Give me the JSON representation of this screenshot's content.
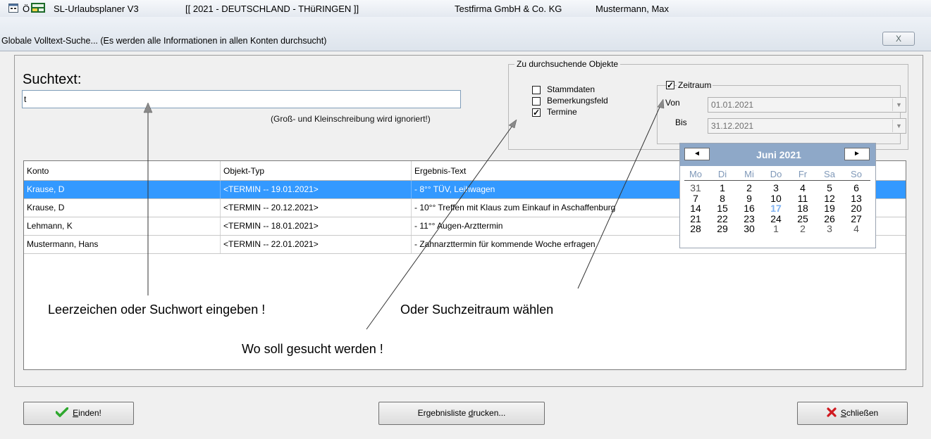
{
  "window": {
    "app_title": "SL-Urlaubsplaner V3",
    "context": "[[ 2021 - DEUTSCHLAND - THüRINGEN ]]",
    "company": "Testfirma GmbH & Co. KG",
    "user": "Mustermann, Max",
    "small_label": "Ö"
  },
  "dialog": {
    "title": "Globale Volltext-Suche... (Es werden alle Informationen in allen Konten durchsucht)",
    "close_label": "X"
  },
  "search": {
    "label": "Suchtext:",
    "value": "t",
    "hint": "(Groß- und Kleinschreibung wird ignoriert!)"
  },
  "objects": {
    "legend": "Zu durchsuchende Objekte",
    "stammdaten": {
      "label": "Stammdaten",
      "checked": false
    },
    "bemerkung": {
      "label": "Bemerkungsfeld",
      "checked": false
    },
    "termine": {
      "label": "Termine",
      "checked": true
    },
    "zeitraum": {
      "label": "Zeitraum",
      "checked": true,
      "von_label": "Von",
      "von_value": "01.01.2021",
      "bis_label": "Bis",
      "bis_value": "31.12.2021"
    }
  },
  "table": {
    "columns": [
      "Konto",
      "Objekt-Typ",
      "Ergebnis-Text"
    ],
    "rows": [
      {
        "konto": "Krause, D",
        "typ": "<TERMIN -- 19.01.2021>",
        "text": "- 8°° TÜV, Leihwagen",
        "selected": true
      },
      {
        "konto": "Krause, D",
        "typ": "<TERMIN -- 20.12.2021>",
        "text": "- 10°° Treffen mit Klaus zum Einkauf in Aschaffenburg",
        "selected": false
      },
      {
        "konto": "Lehmann, K",
        "typ": "<TERMIN -- 18.01.2021>",
        "text": "- 11°° Augen-Arzttermin",
        "selected": false
      },
      {
        "konto": "Mustermann, Hans",
        "typ": "<TERMIN -- 22.01.2021>",
        "text": "- Zahnarzttermin für kommende Woche erfragen",
        "selected": false
      }
    ]
  },
  "calendar": {
    "month": "Juni 2021",
    "prev": "◄",
    "next": "►",
    "weekdays": [
      "Mo",
      "Di",
      "Mi",
      "Do",
      "Fr",
      "Sa",
      "So"
    ],
    "weeks": [
      [
        "31",
        "1",
        "2",
        "3",
        "4",
        "5",
        "6"
      ],
      [
        "7",
        "8",
        "9",
        "10",
        "11",
        "12",
        "13"
      ],
      [
        "14",
        "15",
        "16",
        "17",
        "18",
        "19",
        "20"
      ],
      [
        "21",
        "22",
        "23",
        "24",
        "25",
        "26",
        "27"
      ],
      [
        "28",
        "29",
        "30",
        "1",
        "2",
        "3",
        "4"
      ]
    ],
    "today": "17"
  },
  "annotations": {
    "leerzeichen": "Leerzeichen oder Suchwort eingeben !",
    "zeitraum": "Oder Suchzeitraum wählen",
    "wo": "Wo soll gesucht werden !"
  },
  "buttons": {
    "finden_u": "E",
    "finden_rest": "inden!",
    "drucken_pre": "Ergebnisliste ",
    "drucken_u": "d",
    "drucken_rest": "rucken...",
    "schliessen_u": "S",
    "schliessen_rest": "chließen"
  },
  "colors": {
    "selection": "#3399ff",
    "calendar_header": "#8ea8c8",
    "check_green": "#2ea82e",
    "close_red": "#d0191f"
  }
}
